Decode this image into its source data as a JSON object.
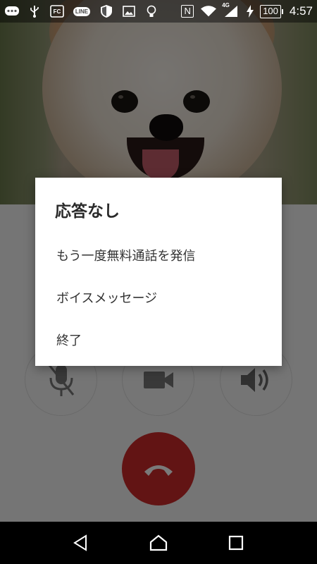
{
  "status_bar": {
    "app_icons": [
      "chat-bubble-icon",
      "usb-icon",
      "fc-icon",
      "line-icon",
      "shield-icon",
      "image-icon",
      "bulb-icon"
    ],
    "fc_label": "FC",
    "line_label": "LINE",
    "nfc_label": "N",
    "network_label": "4G",
    "battery": "100",
    "time": "4:57"
  },
  "dialog": {
    "title": "応答なし",
    "options": [
      {
        "label": "もう一度無料通話を発信"
      },
      {
        "label": "ボイスメッセージ"
      },
      {
        "label": "終了"
      }
    ]
  },
  "call_controls": {
    "mic_icon": "mic-muted-icon",
    "camera_icon": "video-camera-icon",
    "speaker_icon": "speaker-icon",
    "end_call_icon": "end-call-icon",
    "end_call_color": "#cc2b2b"
  },
  "nav_bar": {
    "back_icon": "back-icon",
    "home_icon": "home-icon",
    "recents_icon": "recents-icon"
  }
}
